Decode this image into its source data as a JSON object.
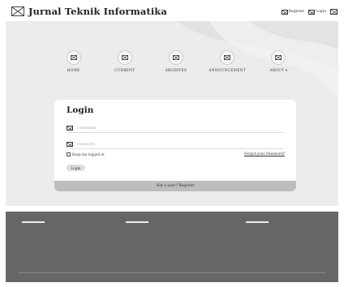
{
  "header": {
    "title": "Jurnal Teknik Informatika",
    "links": [
      {
        "label": "Register",
        "icon": "register-icon"
      },
      {
        "label": "Login",
        "icon": "login-icon"
      }
    ],
    "extra_icon": "image-icon"
  },
  "nav": {
    "items": [
      {
        "label": "HOME",
        "icon": "home-icon"
      },
      {
        "label": "CURRENT",
        "icon": "current-icon"
      },
      {
        "label": "ARCHIVES",
        "icon": "archives-icon"
      },
      {
        "label": "ANNOUNCEMENT",
        "icon": "announcement-icon"
      },
      {
        "label": "ABOUT ▾",
        "icon": "about-icon"
      }
    ]
  },
  "login": {
    "title": "Login",
    "username_placeholder": "Username",
    "password_placeholder": "Password",
    "remember_label": "Keep me logged in",
    "forgot_label": "Forgot your Password?",
    "submit_label": "Login",
    "register_label": "Not a user? Register"
  },
  "footer": {
    "columns": [
      {
        "title": "",
        "lines": [
          "",
          ""
        ]
      },
      {
        "title": "",
        "lines": [
          "",
          ""
        ]
      },
      {
        "title": "",
        "lines": [
          "",
          "",
          ""
        ]
      }
    ],
    "copyright": ""
  },
  "colors": {
    "hero_bg": "#ececec",
    "footer_bg": "#666666",
    "register_bar": "#bdbdbd"
  }
}
